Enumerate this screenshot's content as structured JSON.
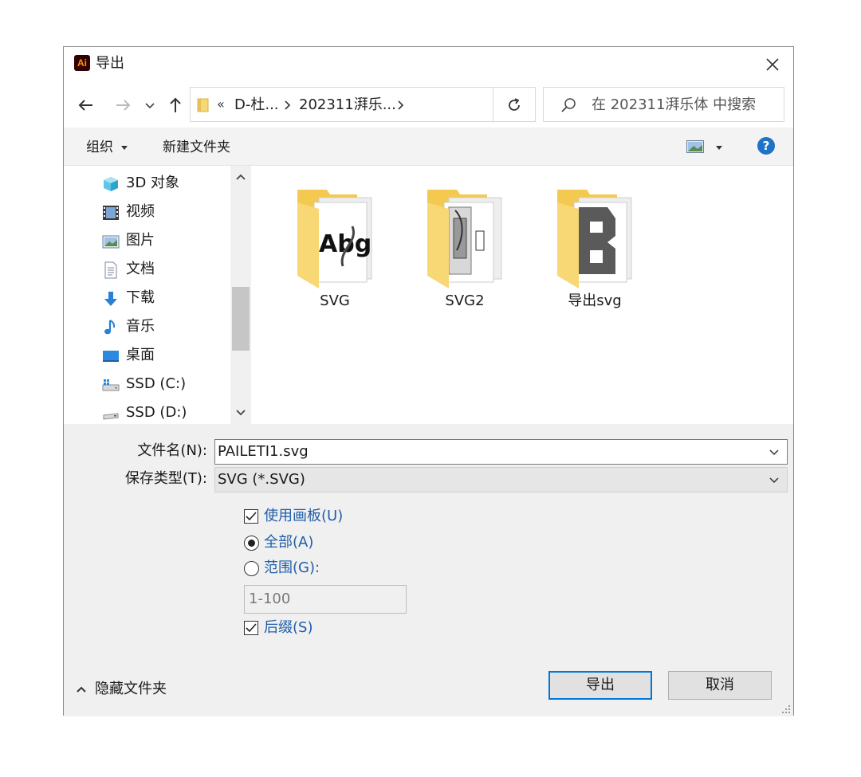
{
  "window": {
    "title": "导出",
    "app_icon_text": "Ai"
  },
  "nav": {
    "breadcrumb_overflow": "«",
    "crumbs": [
      "D-杜...",
      "202311湃乐..."
    ],
    "search_placeholder": "在 202311湃乐体 中搜索"
  },
  "toolbar": {
    "organize": "组织",
    "new_folder": "新建文件夹"
  },
  "sidebar": {
    "items": [
      {
        "label": "3D 对象",
        "icon": "3d-objects-icon"
      },
      {
        "label": "视频",
        "icon": "videos-icon"
      },
      {
        "label": "图片",
        "icon": "pictures-icon"
      },
      {
        "label": "文档",
        "icon": "documents-icon"
      },
      {
        "label": "下载",
        "icon": "downloads-icon"
      },
      {
        "label": "音乐",
        "icon": "music-icon"
      },
      {
        "label": "桌面",
        "icon": "desktop-icon"
      },
      {
        "label": "SSD (C:)",
        "icon": "windows-drive-icon"
      },
      {
        "label": "SSD (D:)",
        "icon": "drive-icon"
      }
    ]
  },
  "files": [
    {
      "name": "SVG"
    },
    {
      "name": "SVG2"
    },
    {
      "name": "导出svg"
    }
  ],
  "form": {
    "filename_label": "文件名(N):",
    "filename_value": "PAILETI1.svg",
    "filetype_label": "保存类型(T):",
    "filetype_value": "SVG (*.SVG)"
  },
  "options": {
    "use_artboards": {
      "label": "使用画板(U)",
      "checked": true
    },
    "all": {
      "label": "全部(A)",
      "selected": true
    },
    "range": {
      "label": "范围(G):",
      "selected": false,
      "value": "1-100"
    },
    "suffix": {
      "label": "后缀(S)",
      "checked": true
    }
  },
  "footer": {
    "hide_folders": "隐藏文件夹",
    "export": "导出",
    "cancel": "取消"
  },
  "colors": {
    "accent": "#0078d7",
    "link_text": "#1f5ea8",
    "folder": "#f8d775",
    "help": "#1e72c8"
  }
}
